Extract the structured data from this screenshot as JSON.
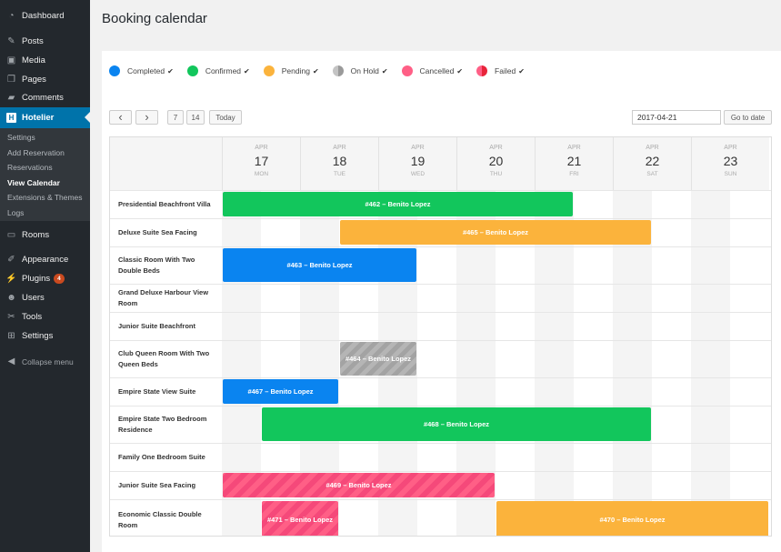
{
  "sidebar": {
    "items": [
      {
        "label": "Dashboard",
        "icon": "dashboard-icon"
      },
      {
        "label": "Posts",
        "icon": "pin-icon"
      },
      {
        "label": "Media",
        "icon": "media-icon"
      },
      {
        "label": "Pages",
        "icon": "pages-icon"
      },
      {
        "label": "Comments",
        "icon": "comments-icon"
      },
      {
        "label": "Hotelier",
        "icon": "hotelier-logo-icon",
        "active": true
      },
      {
        "label": "Rooms",
        "icon": "rooms-icon"
      },
      {
        "label": "Appearance",
        "icon": "appearance-icon"
      },
      {
        "label": "Plugins",
        "icon": "plugins-icon",
        "badge": "4"
      },
      {
        "label": "Users",
        "icon": "users-icon"
      },
      {
        "label": "Tools",
        "icon": "tools-icon"
      },
      {
        "label": "Settings",
        "icon": "settings-icon"
      }
    ],
    "submenu": [
      {
        "label": "Settings"
      },
      {
        "label": "Add Reservation"
      },
      {
        "label": "Reservations"
      },
      {
        "label": "View Calendar",
        "current": true
      },
      {
        "label": "Extensions & Themes"
      },
      {
        "label": "Logs"
      }
    ],
    "collapse_label": "Collapse menu"
  },
  "page": {
    "title": "Booking calendar"
  },
  "legend": [
    {
      "label": "Completed",
      "color": "#0a84f0"
    },
    {
      "label": "Confirmed",
      "color": "#12c65c"
    },
    {
      "label": "Pending",
      "color": "#fbb33c"
    },
    {
      "label": "On Hold",
      "color": "#a9a9a9"
    },
    {
      "label": "Cancelled",
      "color": "#ff5f86"
    },
    {
      "label": "Failed",
      "color": "#e8243a"
    }
  ],
  "toolbar": {
    "prev_label": "‹",
    "next_label": "›",
    "range_7": "7",
    "range_14": "14",
    "today_label": "Today",
    "date_value": "2017-04-21",
    "go_label": "Go to date"
  },
  "days": [
    {
      "month": "APR",
      "day": "17",
      "weekday": "MON"
    },
    {
      "month": "APR",
      "day": "18",
      "weekday": "TUE"
    },
    {
      "month": "APR",
      "day": "19",
      "weekday": "WED"
    },
    {
      "month": "APR",
      "day": "20",
      "weekday": "THU"
    },
    {
      "month": "APR",
      "day": "21",
      "weekday": "FRI"
    },
    {
      "month": "APR",
      "day": "22",
      "weekday": "SAT"
    },
    {
      "month": "APR",
      "day": "23",
      "weekday": "SUN"
    }
  ],
  "rooms": [
    {
      "name": "Presidential Beachfront Villa"
    },
    {
      "name": "Deluxe Suite Sea Facing"
    },
    {
      "name": "Classic Room With Two Double Beds"
    },
    {
      "name": "Grand Deluxe Harbour View Room"
    },
    {
      "name": "Junior Suite Beachfront"
    },
    {
      "name": "Club Queen Room With Two Queen Beds"
    },
    {
      "name": "Empire State View Suite"
    },
    {
      "name": "Empire State Two Bedroom Residence"
    },
    {
      "name": "Family One Bedroom Suite"
    },
    {
      "name": "Junior Suite Sea Facing"
    },
    {
      "name": "Economic Classic Double Room"
    }
  ],
  "bookings": [
    {
      "label": "#462 – Benito Lopez",
      "room": 0,
      "start": 0,
      "end": 4.5,
      "status": "confirmed"
    },
    {
      "label": "#465 – Benito Lopez",
      "room": 1,
      "start": 1.5,
      "end": 5.5,
      "status": "pending"
    },
    {
      "label": "#463 – Benito Lopez",
      "room": 2,
      "start": 0,
      "end": 2.5,
      "status": "completed"
    },
    {
      "label": "#464 – Benito Lopez",
      "room": 5,
      "start": 1.5,
      "end": 2.5,
      "status": "hold"
    },
    {
      "label": "#467 – Benito Lopez",
      "room": 6,
      "start": 0,
      "end": 1.5,
      "status": "completed"
    },
    {
      "label": "#468 – Benito Lopez",
      "room": 7,
      "start": 0.5,
      "end": 5.5,
      "status": "confirmed"
    },
    {
      "label": "#469 – Benito Lopez",
      "room": 9,
      "start": 0,
      "end": 3.5,
      "status": "cancelled"
    },
    {
      "label": "#471 – Benito Lopez",
      "room": 10,
      "start": 0.5,
      "end": 1.5,
      "status": "cancelled"
    },
    {
      "label": "#470 – Benito Lopez",
      "room": 10,
      "start": 3.5,
      "end": 7,
      "status": "pending"
    }
  ]
}
